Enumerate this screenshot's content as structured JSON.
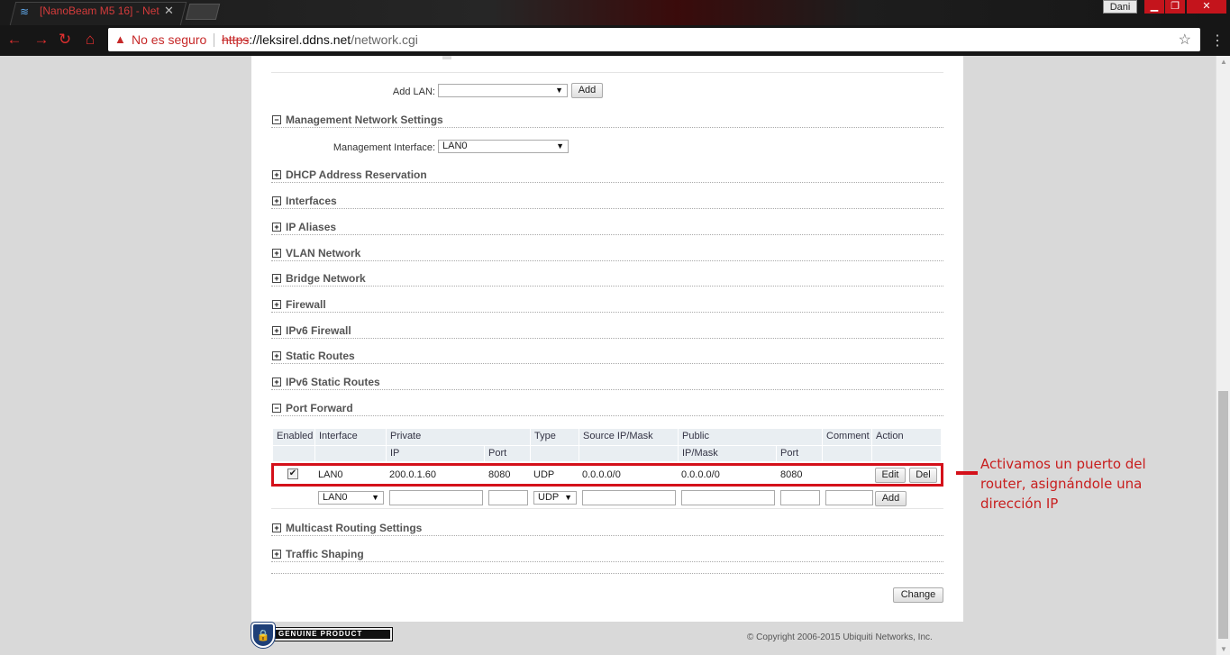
{
  "browser": {
    "tab_title": "[NanoBeam M5 16] - Net",
    "tab_close": "✕",
    "user": "Dani",
    "window_buttons": {
      "minimize": "▁",
      "maximize": "❐",
      "close": "✕"
    },
    "security_label": "No es seguro",
    "url_scheme": "https",
    "url_host": "://leksirel.ddns.net",
    "url_path": "/network.cgi"
  },
  "lan": {
    "add_label": "Add LAN:",
    "select_value": "",
    "add_button": "Add"
  },
  "management": {
    "title": "Management Network Settings",
    "interface_label": "Management Interface:",
    "interface_value": "LAN0"
  },
  "sections": [
    "DHCP Address Reservation",
    "Interfaces",
    "IP Aliases",
    "VLAN Network",
    "Bridge Network",
    "Firewall",
    "IPv6 Firewall",
    "Static Routes",
    "IPv6 Static Routes"
  ],
  "port_forward": {
    "title": "Port Forward",
    "headers": {
      "enabled": "Enabled",
      "interface": "Interface",
      "private": "Private",
      "type": "Type",
      "source": "Source IP/Mask",
      "public": "Public",
      "comment": "Comment",
      "action": "Action"
    },
    "subheaders": {
      "ip": "IP",
      "port": "Port",
      "ipmask": "IP/Mask",
      "public_port": "Port"
    },
    "rule": {
      "enabled": true,
      "interface": "LAN0",
      "private_ip": "200.0.1.60",
      "private_port": "8080",
      "type": "UDP",
      "source": "0.0.0.0/0",
      "public_ipmask": "0.0.0.0/0",
      "public_port": "8080",
      "comment": "",
      "edit_button": "Edit",
      "del_button": "Del"
    },
    "new_rule": {
      "interface": "LAN0",
      "type": "UDP",
      "add_button": "Add"
    }
  },
  "bottom_sections": [
    "Multicast Routing Settings",
    "Traffic Shaping"
  ],
  "change_button": "Change",
  "badge": "GENUINE PRODUCT",
  "copyright": "© Copyright 2006-2015 Ubiquiti Networks, Inc.",
  "annotation": {
    "lines": [
      "Activamos un puerto del",
      "router, asignándole una",
      "dirección IP"
    ]
  },
  "colors": {
    "annotation_red": "#d4101a",
    "header_bg": "#e9eef2",
    "section_title": "#555555"
  }
}
